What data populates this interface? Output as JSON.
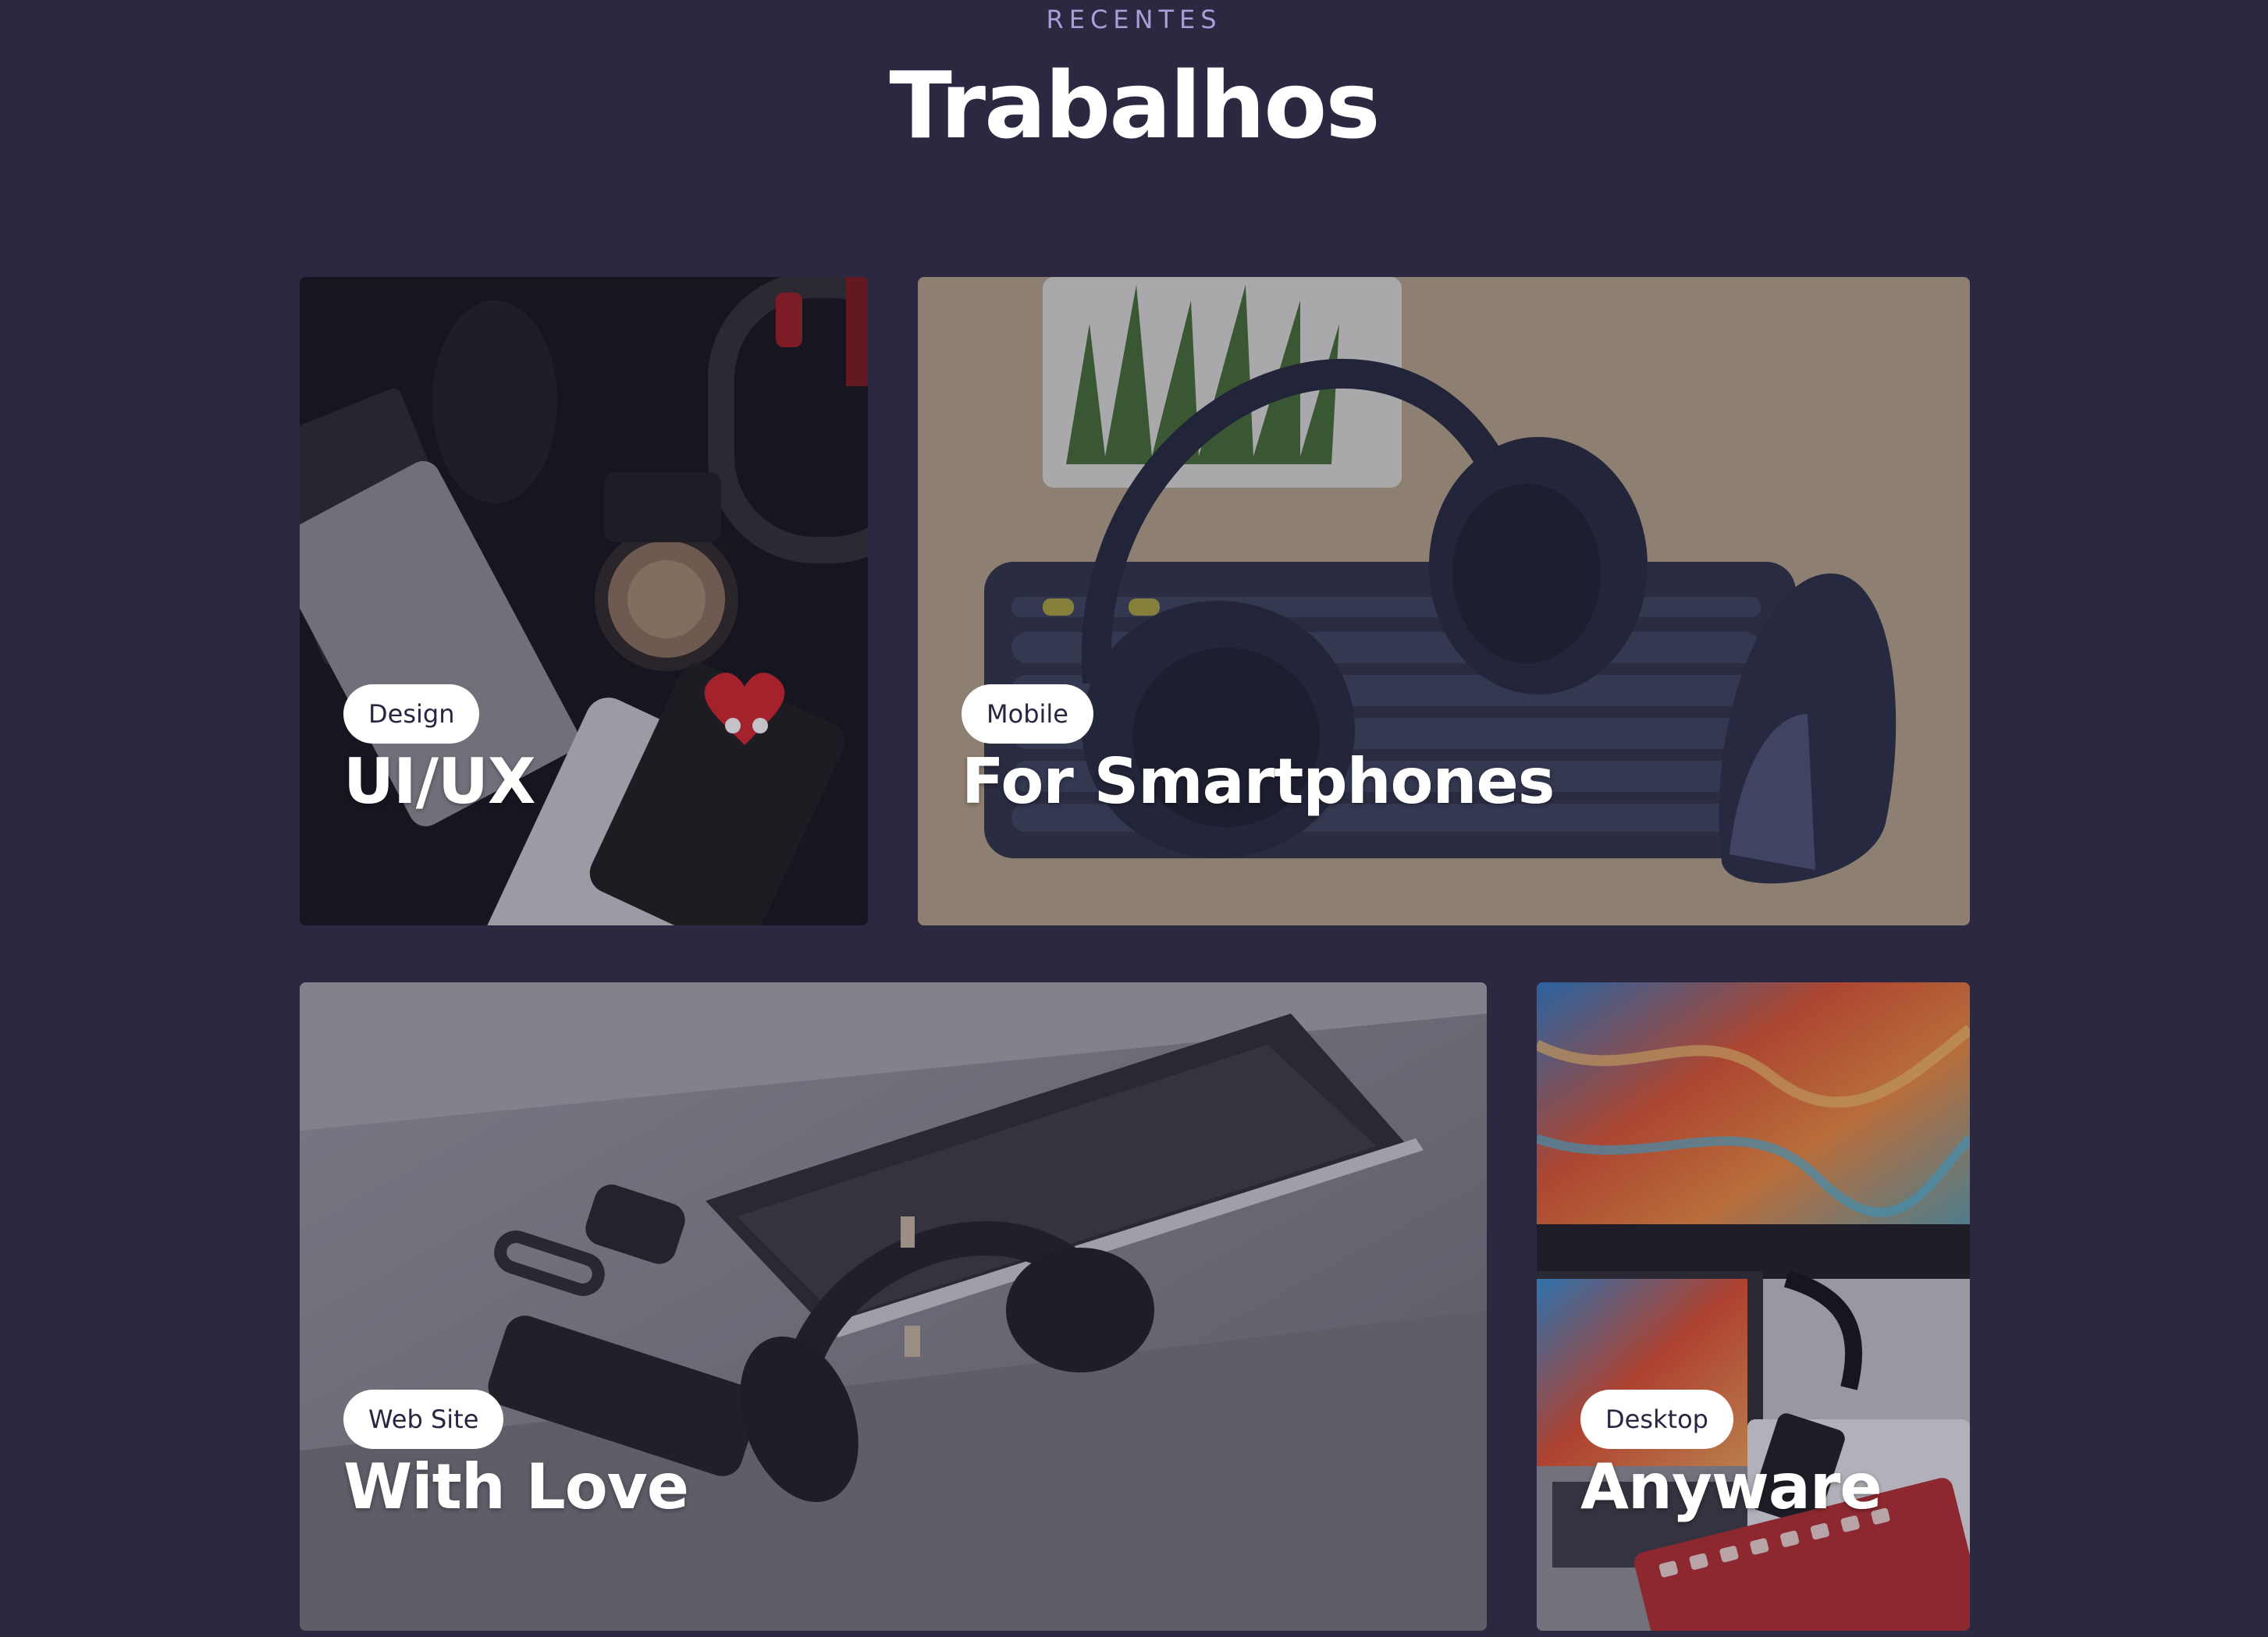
{
  "section": {
    "eyebrow": "RECENTES",
    "title": "Trabalhos"
  },
  "projects": [
    {
      "tag": "Design",
      "title": "UI/UX",
      "image": "dark-desk-iphone-coffee-photo"
    },
    {
      "tag": "Mobile",
      "title": "For Smartphones",
      "image": "headphones-keyboard-mouse-photo"
    },
    {
      "tag": "Web Site",
      "title": "With Love",
      "image": "laptop-headphones-phone-photo"
    },
    {
      "tag": "Desktop",
      "title": "Anyware",
      "image": "monitor-macbook-ipad-photo"
    }
  ],
  "colors": {
    "background": "#2d2842",
    "eyebrow": "#a79fd6",
    "tag_bg": "#ffffff",
    "tag_text": "#2a2440"
  }
}
